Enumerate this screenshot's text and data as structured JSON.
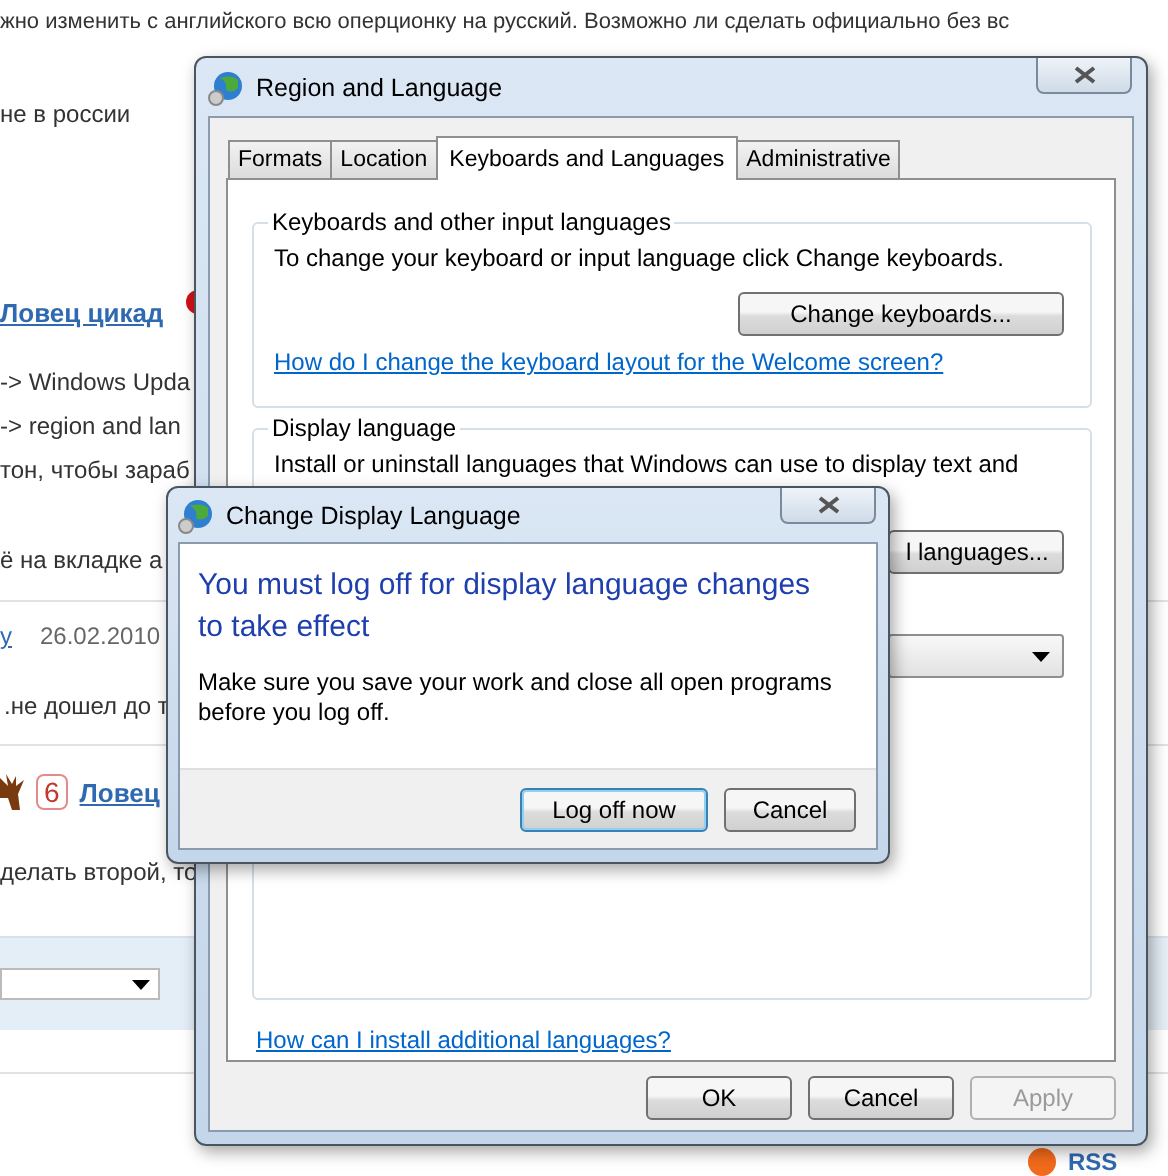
{
  "forum": {
    "intro": "жно изменить с английского всю оперционку на русский. Возможно ли сделать официально без вс",
    "location": "не в россии",
    "post1": {
      "author": "Ловец цикад",
      "lines": [
        "-> Windows Upda",
        "-> region and lan",
        "тон, чтобы зараб",
        "ё на вкладке а"
      ]
    },
    "post2": {
      "author": "y",
      "date": "26.02.2010",
      "lines": [
        ".не дошел до т"
      ]
    },
    "post3": {
      "badge": "6",
      "author": "Ловец",
      "lines": [
        "делать второй, то"
      ]
    },
    "rss": "RSS"
  },
  "dialog": {
    "title": "Region and Language",
    "tabs": [
      {
        "label": "Formats",
        "selected": false
      },
      {
        "label": "Location",
        "selected": false
      },
      {
        "label": "Keyboards and Languages",
        "selected": true
      },
      {
        "label": "Administrative",
        "selected": false
      }
    ],
    "keyboards_group": {
      "title": "Keyboards and other input languages",
      "text": "To change your keyboard or input language click Change keyboards.",
      "button": "Change keyboards...",
      "link": "How do I change the keyboard layout for the Welcome screen?"
    },
    "display_group": {
      "title": "Display language",
      "text": "Install or uninstall languages that Windows can use to display text and",
      "button": "l languages..."
    },
    "link": "How can I install additional languages?",
    "buttons": [
      {
        "label": "OK",
        "disabled": false
      },
      {
        "label": "Cancel",
        "disabled": false
      },
      {
        "label": "Apply",
        "disabled": true
      }
    ]
  },
  "modal": {
    "title": "Change Display Language",
    "heading": "You must log off for display language changes to take effect",
    "message": "Make sure you save your work and close all open programs before you log off.",
    "buttons": [
      {
        "label": "Log off now",
        "default": true
      },
      {
        "label": "Cancel",
        "default": false
      }
    ]
  }
}
